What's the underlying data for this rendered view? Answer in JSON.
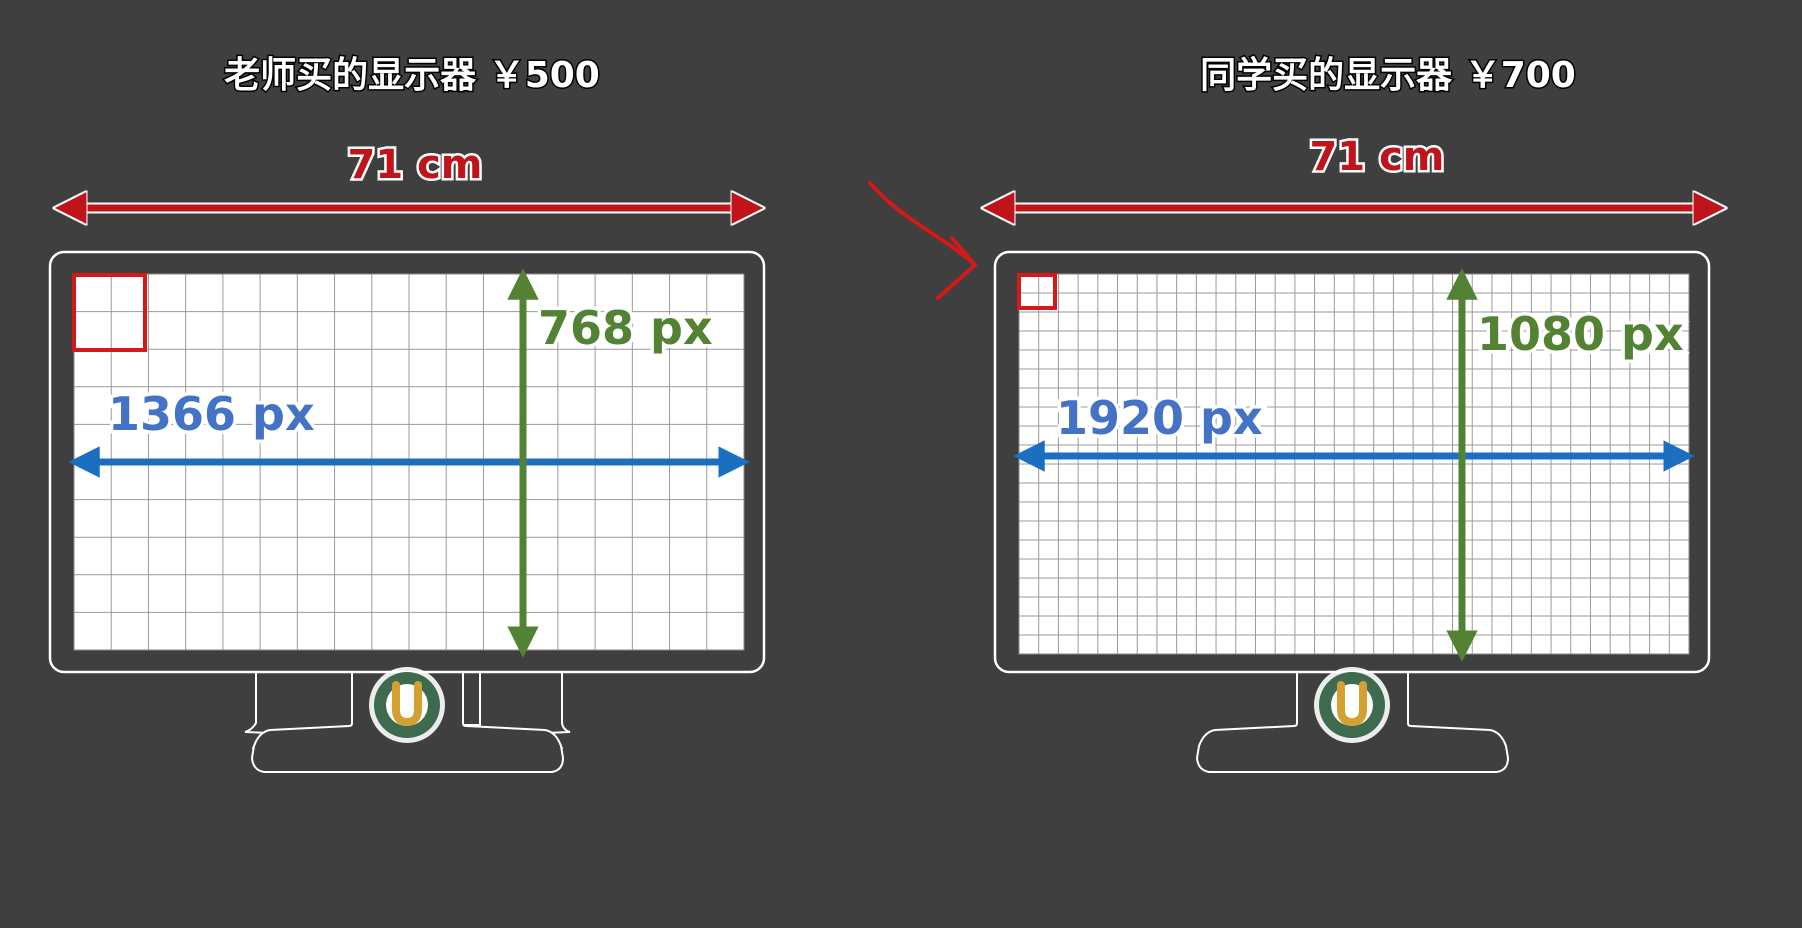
{
  "colors": {
    "background": "#3f3f3f",
    "bezel": "#3f3f3f",
    "outline": "#ffffff",
    "width_arrow": "#c0141c",
    "horizontal_arrow": "#1a6fc0",
    "vertical_arrow": "#548235",
    "pixel_box": "#d41919",
    "logo_ring": "#3e6b4e",
    "logo_u": "#d4a031"
  },
  "annotation": {
    "icon": "curved-arrow-icon",
    "color": "#d41919"
  },
  "monitors": [
    {
      "title": "老师买的显示器 ￥500",
      "width_label": "71 cm",
      "horizontal_label": "1366 px",
      "vertical_label": "768 px",
      "resolution": {
        "horizontal": 1366,
        "vertical": 768
      },
      "grid": {
        "columns": 18,
        "rows": 10
      },
      "logo_letter": "U"
    },
    {
      "title": "同学买的显示器  ￥700",
      "width_label": "71 cm",
      "horizontal_label": "1920 px",
      "vertical_label": "1080 px",
      "resolution": {
        "horizontal": 1920,
        "vertical": 1080
      },
      "grid": {
        "columns": 34,
        "rows": 20
      },
      "logo_letter": "U"
    }
  ]
}
